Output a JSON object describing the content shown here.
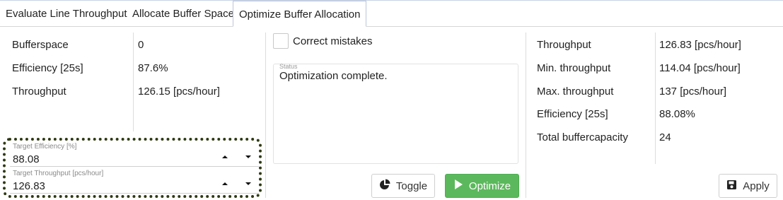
{
  "tabs": [
    {
      "label": "Evaluate Line Throughput"
    },
    {
      "label": "Allocate Buffer Space"
    },
    {
      "label": "Optimize Buffer Allocation"
    }
  ],
  "left_table": [
    {
      "label": "Bufferspace",
      "value": "0"
    },
    {
      "label": "Efficiency [25s]",
      "value": "87.6%"
    },
    {
      "label": "Throughput",
      "value": "126.15 [pcs/hour]"
    }
  ],
  "targets": {
    "efficiency": {
      "label": "Target Efficiency [%]",
      "value": "88.08"
    },
    "throughput": {
      "label": "Target Throughput [pcs/hour]",
      "value": "126.83"
    }
  },
  "middle": {
    "checkbox_label": "Correct mistakes",
    "status_label": "Status",
    "status_text": "Optimization complete.",
    "toggle_label": "Toggle",
    "optimize_label": "Optimize"
  },
  "right_table": [
    {
      "label": "Throughput",
      "value": "126.83 [pcs/hour]"
    },
    {
      "label": "Min. throughput",
      "value": "114.04 [pcs/hour]"
    },
    {
      "label": "Max. throughput",
      "value": "137 [pcs/hour]"
    },
    {
      "label": "Efficiency [25s]",
      "value": "88.08%"
    },
    {
      "label": "Total buffercapacity",
      "value": "24"
    }
  ],
  "apply_label": "Apply",
  "colors": {
    "optimize_button": "#5cb85c",
    "target_outline": "#2e3a12"
  }
}
